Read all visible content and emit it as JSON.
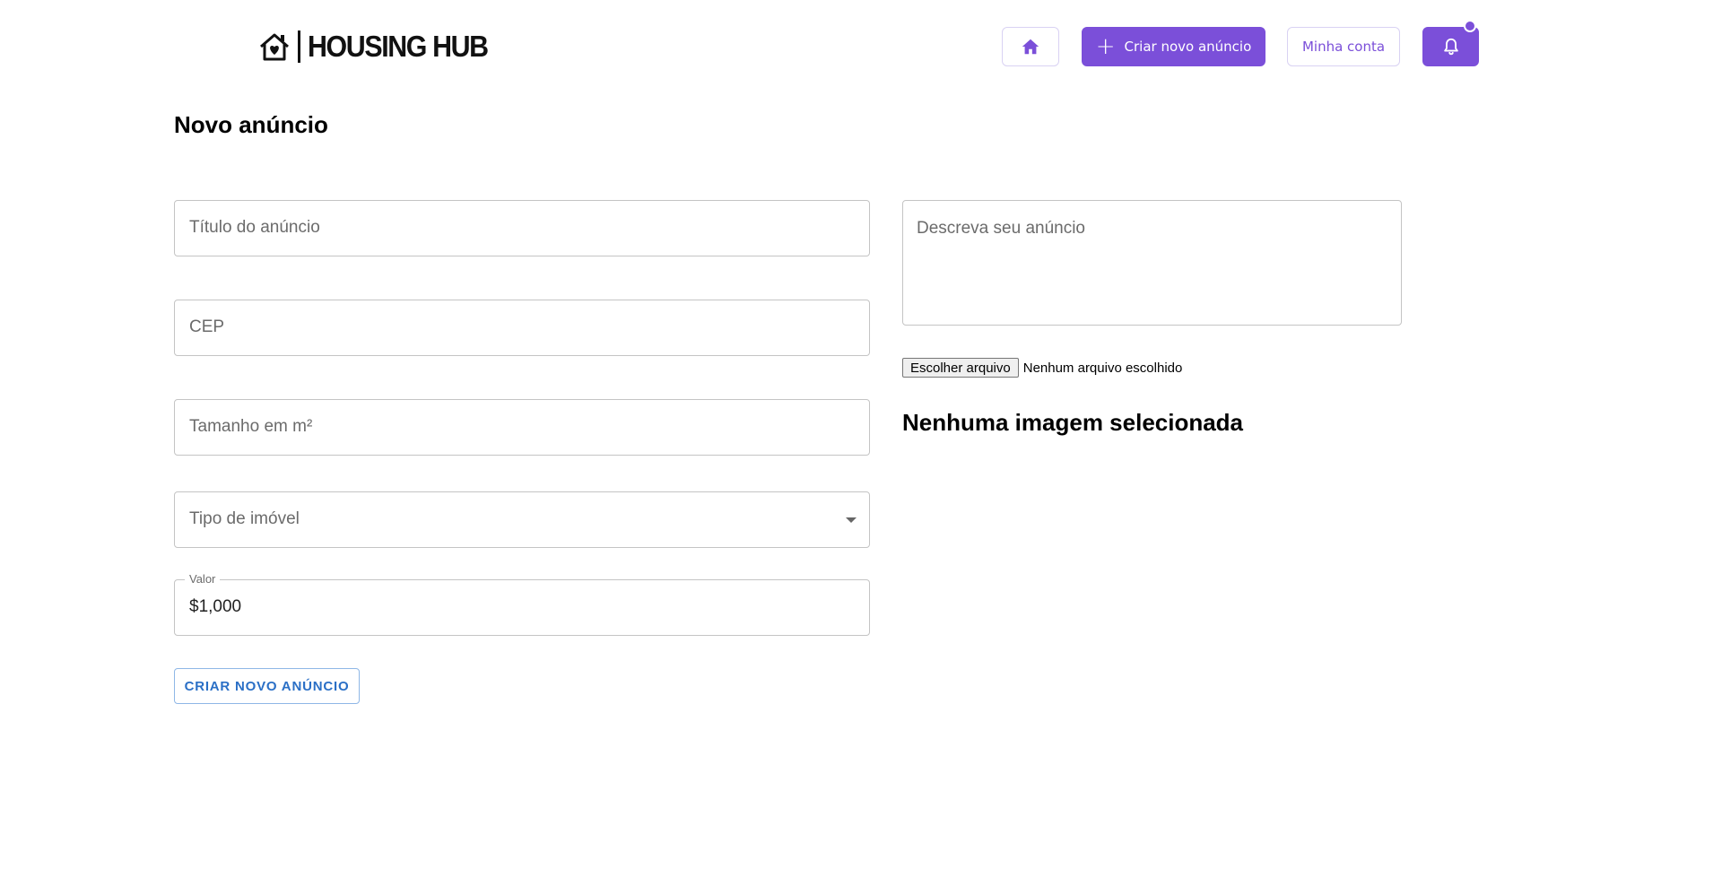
{
  "header": {
    "logo_text": "HOUSING HUB",
    "nav": {
      "home_icon": "home-icon",
      "create_label": "Criar novo anúncio",
      "account_label": "Minha conta",
      "bell_icon": "bell-icon"
    }
  },
  "page": {
    "title": "Novo anúncio"
  },
  "form": {
    "title_placeholder": "Título do anúncio",
    "cep_placeholder": "CEP",
    "size_placeholder": "Tamanho em m²",
    "type_placeholder": "Tipo de imóvel",
    "value_label": "Valor",
    "value_value": "$1,000",
    "description_placeholder": "Descreva seu anúncio",
    "file_button_label": "Escolher arquivo",
    "file_status": "Nenhum arquivo escolhido",
    "no_image_text": "Nenhuma imagem selecionada",
    "submit_label": "CRIAR NOVO ANÚNCIO"
  },
  "colors": {
    "accent": "#7b4fd9",
    "submit_text": "#2a6fc6",
    "border": "#c4c4c4"
  }
}
